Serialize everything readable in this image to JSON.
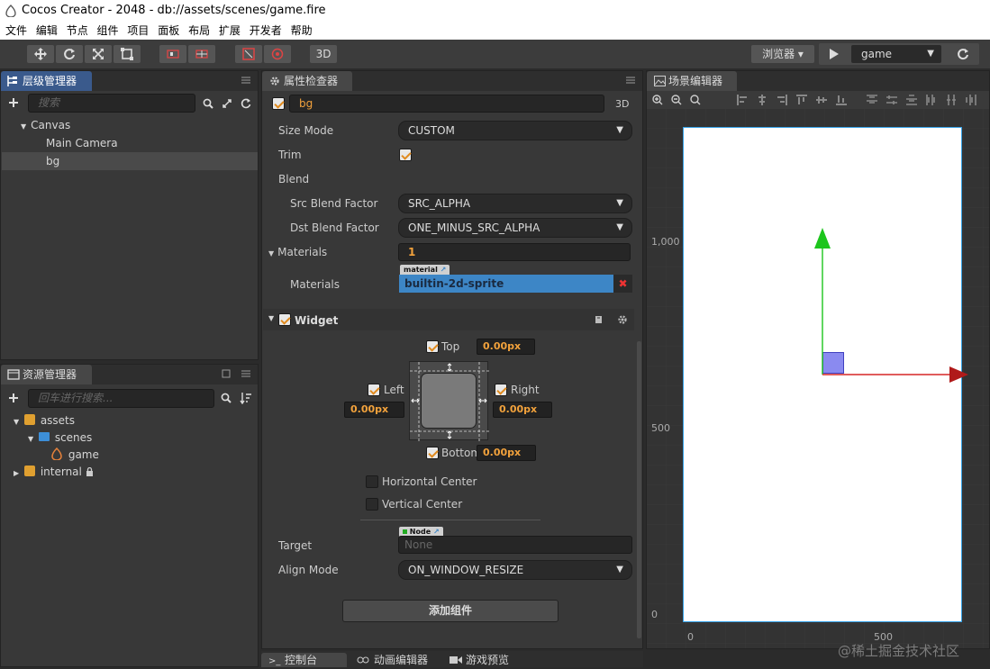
{
  "window": {
    "title": "Cocos Creator - 2048 - db://assets/scenes/game.fire"
  },
  "menu": [
    "文件",
    "编辑",
    "节点",
    "组件",
    "项目",
    "面板",
    "布局",
    "扩展",
    "开发者",
    "帮助"
  ],
  "toolbar": {
    "mode3d": "3D",
    "browser_label": "浏览器 ▾",
    "scene_select": "game"
  },
  "hierarchy": {
    "title": "层级管理器",
    "search_placeholder": "搜索",
    "items": [
      {
        "label": "Canvas"
      },
      {
        "label": "Main Camera"
      },
      {
        "label": "bg"
      }
    ]
  },
  "assets": {
    "title": "资源管理器",
    "search_placeholder": "回车进行搜索...",
    "items": [
      {
        "label": "assets"
      },
      {
        "label": "scenes"
      },
      {
        "label": "game"
      },
      {
        "label": "internal"
      }
    ]
  },
  "inspector": {
    "title": "属性检查器",
    "node_name": "bg",
    "mode3d": "3D",
    "sprite": {
      "size_mode_label": "Size Mode",
      "size_mode_value": "CUSTOM",
      "trim_label": "Trim",
      "blend_label": "Blend",
      "src_label": "Src Blend Factor",
      "src_value": "SRC_ALPHA",
      "dst_label": "Dst Blend Factor",
      "dst_value": "ONE_MINUS_SRC_ALPHA",
      "materials_label": "Materials",
      "materials_count": "1",
      "material_tag": "material",
      "materials_item_label": "Materials",
      "material_value": "builtin-2d-sprite"
    },
    "widget": {
      "title": "Widget",
      "top_label": "Top",
      "top_value": "0.00px",
      "left_label": "Left",
      "left_value": "0.00px",
      "right_label": "Right",
      "right_value": "0.00px",
      "bottom_label": "Bottom",
      "bottom_value": "0.00px",
      "hcenter_label": "Horizontal Center",
      "vcenter_label": "Vertical Center",
      "target_label": "Target",
      "target_tag": "Node",
      "target_value": "None",
      "align_label": "Align Mode",
      "align_value": "ON_WINDOW_RESIZE"
    },
    "add_component": "添加组件"
  },
  "scene": {
    "title": "场景编辑器",
    "ruler_y": [
      "1,000",
      "500",
      "0"
    ],
    "ruler_x": [
      "0",
      "500"
    ]
  },
  "bottom_tabs": [
    "控制台",
    "动画编辑器",
    "游戏预览"
  ],
  "watermark": "@稀土掘金技术社区",
  "colors": {
    "accent": "#e08a1e",
    "selection": "#3d86c6",
    "canvas": "#ffffff"
  }
}
